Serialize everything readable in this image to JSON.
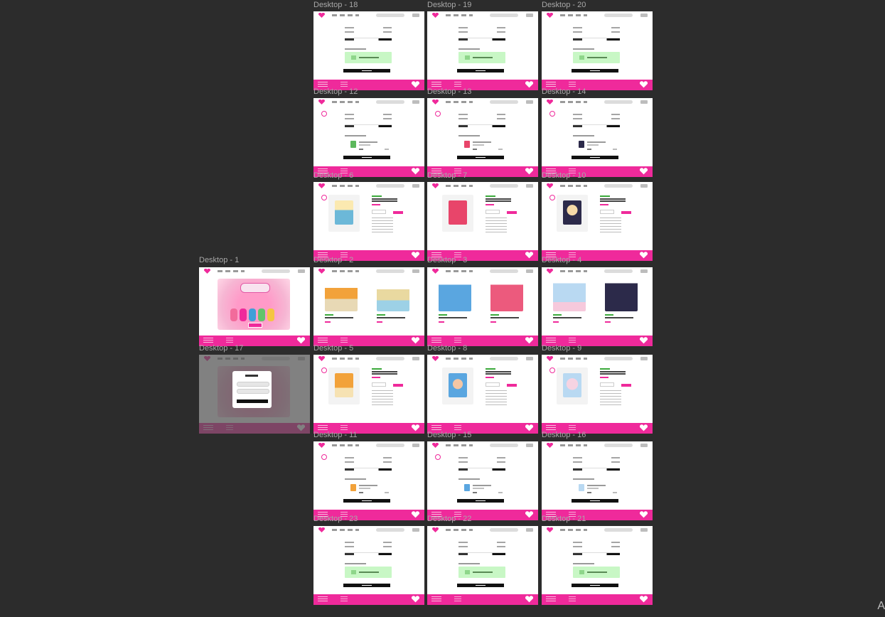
{
  "canvas": {
    "background": "#2c2c2c",
    "accent": "#ef2a9b",
    "corner_text": "A"
  },
  "frames": {
    "d18": "Desktop - 18",
    "d19": "Desktop - 19",
    "d20": "Desktop - 20",
    "d12": "Desktop - 12",
    "d13": "Desktop - 13",
    "d14": "Desktop - 14",
    "d6": "Desktop - 6",
    "d7": "Desktop - 7",
    "d10": "Desktop - 10",
    "d1": "Desktop - 1",
    "d2": "Desktop - 2",
    "d3": "Desktop - 3",
    "d4": "Desktop - 4",
    "d17": "Desktop - 17",
    "d5": "Desktop - 5",
    "d8": "Desktop - 8",
    "d9": "Desktop - 9",
    "d11": "Desktop - 11",
    "d15": "Desktop - 15",
    "d16": "Desktop - 16",
    "d23": "Desktop - 23",
    "d22": "Desktop - 22",
    "d21": "Desktop - 21"
  }
}
